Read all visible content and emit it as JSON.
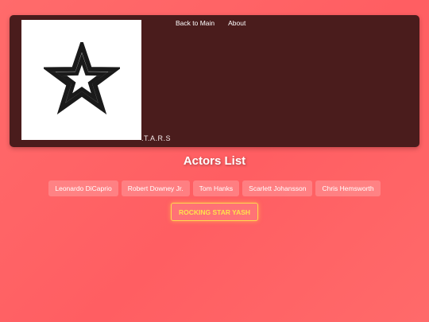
{
  "header": {
    "logo_icon": "star-icon",
    "logo_text": ".T.A.R.S",
    "nav": [
      {
        "label": "Back to Main"
      },
      {
        "label": "About"
      }
    ]
  },
  "main": {
    "title": "Actors List",
    "actors": [
      {
        "label": "Leonardo DiCaprio"
      },
      {
        "label": "Robert Downey Jr."
      },
      {
        "label": "Tom Hanks"
      },
      {
        "label": "Scarlett Johansson"
      },
      {
        "label": "Chris Hemsworth"
      }
    ],
    "featured_label": "ROCKING STAR YASH"
  },
  "colors": {
    "background": "#ff5e62",
    "header_bg": "#4a1c1c",
    "featured_accent": "#ffd84d"
  }
}
